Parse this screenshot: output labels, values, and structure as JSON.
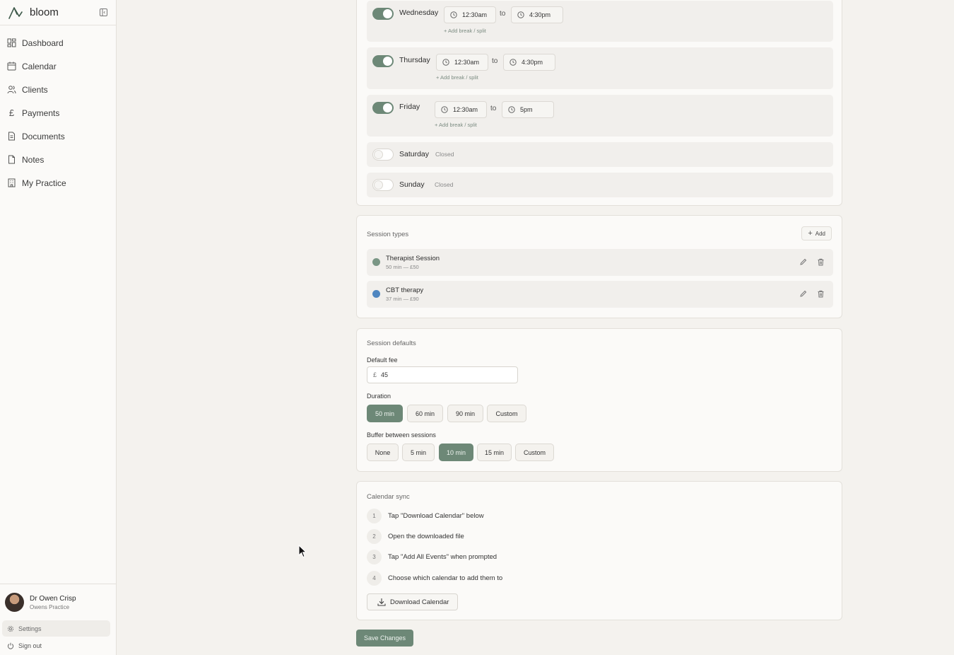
{
  "app": {
    "name": "bloom"
  },
  "nav": {
    "dashboard": "Dashboard",
    "calendar": "Calendar",
    "clients": "Clients",
    "payments": "Payments",
    "documents": "Documents",
    "notes": "Notes",
    "practice": "My Practice"
  },
  "user": {
    "name": "Dr Owen Crisp",
    "practice": "Owens Practice"
  },
  "settings_label": "Settings",
  "signout_label": "Sign out",
  "hours": {
    "wednesday": {
      "day": "Wednesday",
      "start": "12:30am",
      "end": "4:30pm",
      "enabled": true
    },
    "thursday": {
      "day": "Thursday",
      "start": "12:30am",
      "end": "4:30pm",
      "enabled": true
    },
    "friday": {
      "day": "Friday",
      "start": "12:30am",
      "end": "5pm",
      "enabled": true
    },
    "saturday": {
      "day": "Saturday",
      "status": "Closed",
      "enabled": false
    },
    "sunday": {
      "day": "Sunday",
      "status": "Closed",
      "enabled": false
    },
    "to": "to",
    "add_break": "+ Add break / split"
  },
  "session_types": {
    "title": "Session types",
    "add": "Add",
    "items": [
      {
        "name": "Therapist Session",
        "meta": "50 min — £50",
        "color": "#7a9685"
      },
      {
        "name": "CBT therapy",
        "meta": "37 min — £90",
        "color": "#4f86c0"
      }
    ]
  },
  "session_defaults": {
    "title": "Session defaults",
    "fee_label": "Default fee",
    "currency": "£",
    "fee": "45",
    "duration_label": "Duration",
    "duration_options": [
      "50 min",
      "60 min",
      "90 min",
      "Custom"
    ],
    "duration_selected": "50 min",
    "buffer_label": "Buffer between sessions",
    "buffer_options": [
      "None",
      "5 min",
      "10 min",
      "15 min",
      "Custom"
    ],
    "buffer_selected": "10 min"
  },
  "calendar_sync": {
    "title": "Calendar sync",
    "steps": [
      {
        "num": "1",
        "text": "Tap \"Download Calendar\" below"
      },
      {
        "num": "2",
        "text": "Open the downloaded file"
      },
      {
        "num": "3",
        "text": "Tap \"Add All Events\" when prompted"
      },
      {
        "num": "4",
        "text": "Choose which calendar to add them to"
      }
    ],
    "download": "Download Calendar"
  },
  "save_label": "Save Changes",
  "colors": {
    "accent": "#6d8877"
  }
}
